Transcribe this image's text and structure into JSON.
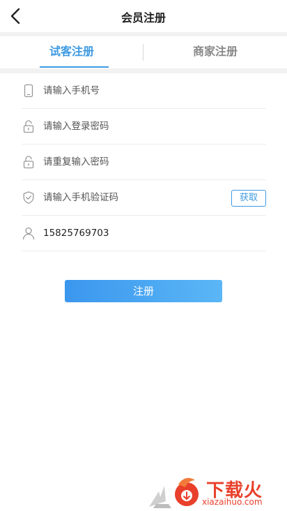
{
  "header": {
    "title": "会员注册",
    "back_icon": "chevron-left-icon"
  },
  "tabs": [
    {
      "label": "试客注册",
      "active": true
    },
    {
      "label": "商家注册",
      "active": false
    }
  ],
  "form": {
    "phone": {
      "placeholder": "请输入手机号",
      "icon": "phone-icon",
      "value": ""
    },
    "password": {
      "placeholder": "请输入登录密码",
      "icon": "lock-icon",
      "value": ""
    },
    "repeat_password": {
      "placeholder": "请重复输入密码",
      "icon": "lock-icon",
      "value": ""
    },
    "sms_code": {
      "placeholder": "请输入手机验证码",
      "icon": "shield-check-icon",
      "value": "",
      "button_label": "获取"
    },
    "referrer": {
      "value": "15825769703",
      "icon": "user-icon"
    }
  },
  "submit": {
    "label": "注册"
  },
  "watermark": {
    "brand": "下载火",
    "url": "xiazaihuo.com"
  },
  "colors": {
    "accent": "#3d9ae2",
    "button_gradient_start": "#3b97ee",
    "button_gradient_end": "#5bb6f6",
    "watermark": "#e8402b"
  }
}
